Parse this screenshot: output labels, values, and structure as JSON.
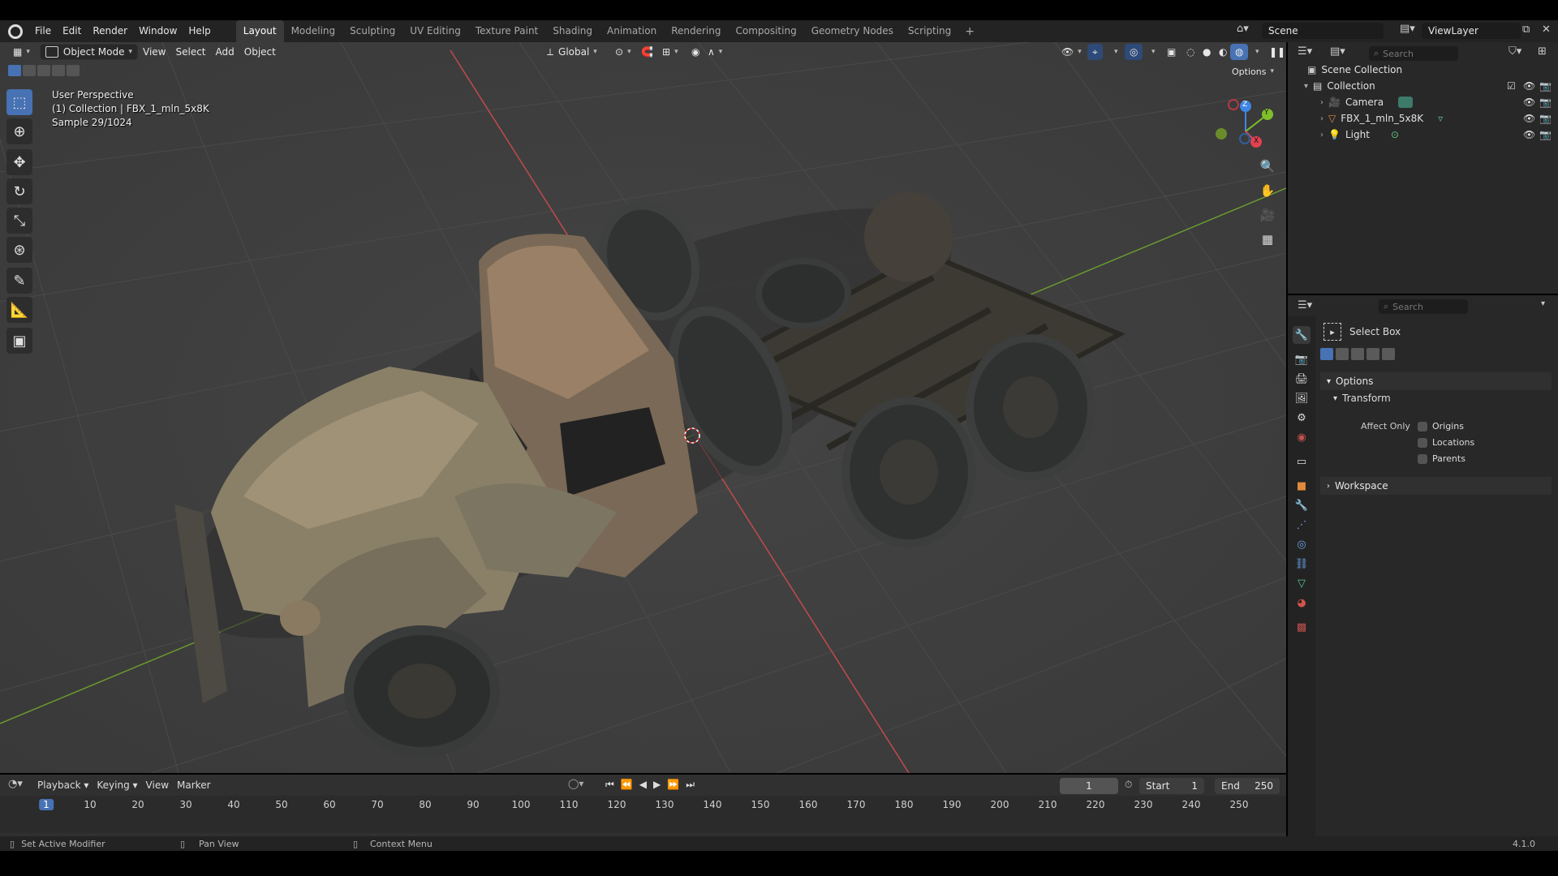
{
  "menu": [
    "File",
    "Edit",
    "Render",
    "Window",
    "Help"
  ],
  "workspaces": [
    "Layout",
    "Modeling",
    "Sculpting",
    "UV Editing",
    "Texture Paint",
    "Shading",
    "Animation",
    "Rendering",
    "Compositing",
    "Geometry Nodes",
    "Scripting"
  ],
  "scene_label": "Scene",
  "viewlayer_label": "ViewLayer",
  "viewport": {
    "mode": "Object Mode",
    "menus": [
      "View",
      "Select",
      "Add",
      "Object"
    ],
    "transform_orientation": "Global",
    "options": "Options",
    "overlay_lines": [
      "User Perspective",
      "(1) Collection | FBX_1_mln_5x8K",
      "Sample 29/1024"
    ],
    "gizmo_axes": [
      "Z",
      "Y",
      "X"
    ]
  },
  "outliner": {
    "search_placeholder": "Search",
    "root": "Scene Collection",
    "collection": "Collection",
    "items": [
      "Camera",
      "FBX_1_mln_5x8K",
      "Light"
    ]
  },
  "properties": {
    "search_placeholder": "Search",
    "tool_name": "Select Box",
    "options_panel": "Options",
    "transform_panel": "Transform",
    "affect_only_label": "Affect Only",
    "checkboxes": [
      "Origins",
      "Locations",
      "Parents"
    ],
    "workspace_panel": "Workspace"
  },
  "timeline": {
    "menus": [
      "Playback",
      "Keying",
      "View",
      "Marker"
    ],
    "current_frame": "1",
    "start_label": "Start",
    "start_value": "1",
    "end_label": "End",
    "end_value": "250",
    "ticks": [
      "1",
      "10",
      "20",
      "30",
      "40",
      "50",
      "60",
      "70",
      "80",
      "90",
      "100",
      "110",
      "120",
      "130",
      "140",
      "150",
      "160",
      "170",
      "180",
      "190",
      "200",
      "210",
      "220",
      "230",
      "240",
      "250"
    ]
  },
  "status": {
    "left": "Set Active Modifier",
    "middle": "Pan View",
    "right": "Context Menu",
    "version": "4.1.0"
  },
  "colors": {
    "accent": "#4772b3",
    "x_axis": "#e0424f",
    "y_axis": "#7fbf2a",
    "z_axis": "#3f87e6"
  }
}
